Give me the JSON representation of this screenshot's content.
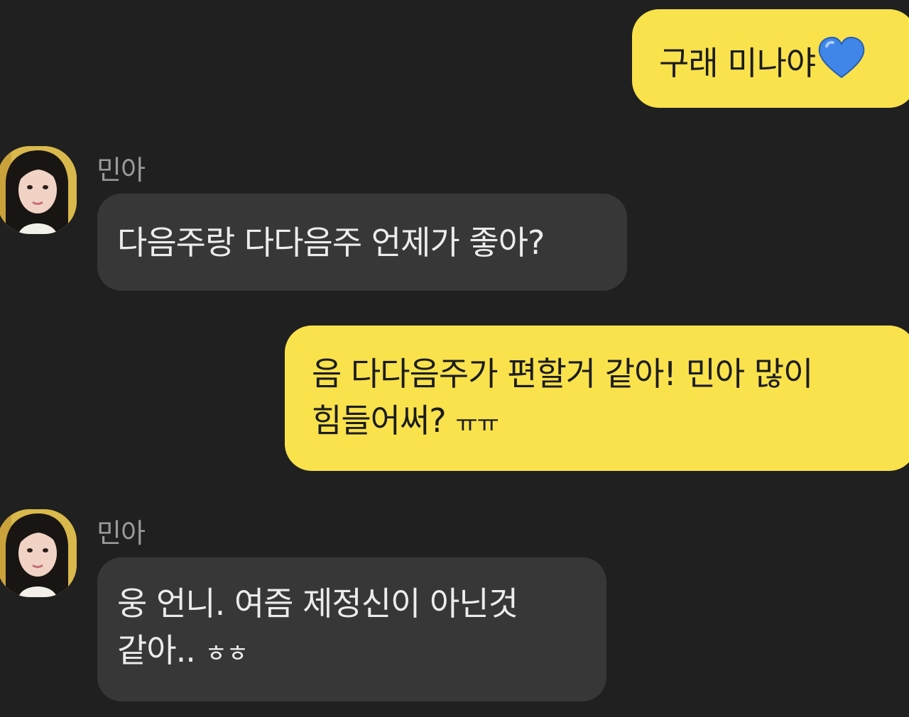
{
  "messages": [
    {
      "from": "me",
      "text": "구래 미나야",
      "emoji": "blue-heart"
    },
    {
      "from": "them",
      "sender": "민아",
      "text": "다음주랑 다다음주 언제가 좋아?"
    },
    {
      "from": "me",
      "line1": "음 다다음주가 편할거 같아! 민아 많이",
      "line2": "힘들어써? ",
      "line2_suffix": "ㅠㅠ"
    },
    {
      "from": "them",
      "sender": "민아",
      "line1": "웅 언니. 여즘 제정신이 아닌것",
      "line2": "같아.. ",
      "line2_suffix": "ㅎㅎ"
    }
  ],
  "colors": {
    "background": "#202020",
    "my_bubble": "#f9e24c",
    "their_bubble": "#373737",
    "heart": "#3f86e8"
  }
}
